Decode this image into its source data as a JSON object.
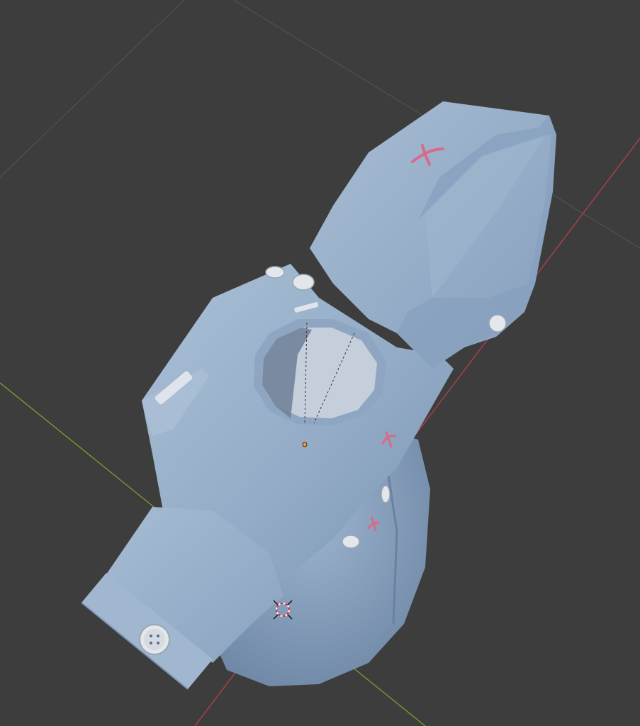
{
  "app": "3d-viewport",
  "viewport": {
    "background_color": "#3d3d3d",
    "grid_color": "#5a5a5a",
    "axis_x_color": "#b5404a",
    "axis_y_color": "#7aa12e"
  },
  "model": {
    "description_icon": "shirt-mesh",
    "base_color": "#97aec8",
    "shadow_color": "#6f88a6",
    "highlight_color": "#b3c6da",
    "stitch_color": "#d86a8a",
    "button_color": "#e6e9ee"
  },
  "gizmos": {
    "origin_icon": "origin-point-icon",
    "origin_color": "#ff9a1e",
    "cursor_icon": "3d-cursor-icon"
  }
}
